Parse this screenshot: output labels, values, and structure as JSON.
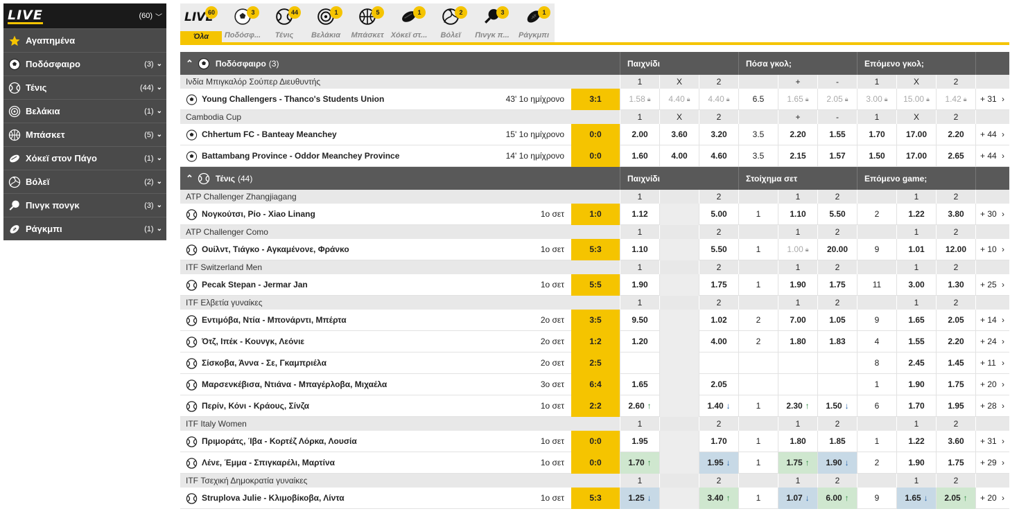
{
  "sidebar": {
    "logo": "LIVE",
    "count": "(60)",
    "items": [
      {
        "icon": "star-icon",
        "label": "Αγαπημένα",
        "count": ""
      },
      {
        "icon": "football-icon",
        "label": "Ποδόσφαιρο",
        "count": "(3)"
      },
      {
        "icon": "tennis-icon",
        "label": "Τένις",
        "count": "(44)"
      },
      {
        "icon": "darts-icon",
        "label": "Βελάκια",
        "count": "(1)"
      },
      {
        "icon": "basketball-icon",
        "label": "Μπάσκετ",
        "count": "(5)"
      },
      {
        "icon": "hockey-icon",
        "label": "Χόκεϊ στον Πάγο",
        "count": "(1)"
      },
      {
        "icon": "volleyball-icon",
        "label": "Βόλεϊ",
        "count": "(2)"
      },
      {
        "icon": "pingpong-icon",
        "label": "Πινγκ πονγκ",
        "count": "(3)"
      },
      {
        "icon": "rugby-icon",
        "label": "Ράγκμπι",
        "count": "(1)"
      }
    ]
  },
  "tabs": [
    {
      "icon": "live-icon",
      "label": "Όλα",
      "badge": "60",
      "active": true
    },
    {
      "icon": "football-icon",
      "label": "Ποδόσφ...",
      "badge": "3"
    },
    {
      "icon": "tennis-icon",
      "label": "Τένις",
      "badge": "44"
    },
    {
      "icon": "darts-icon",
      "label": "Βελάκια",
      "badge": "1"
    },
    {
      "icon": "basketball-icon",
      "label": "Μπάσκετ",
      "badge": "5"
    },
    {
      "icon": "hockey-icon",
      "label": "Χόκεϊ στ...",
      "badge": "1"
    },
    {
      "icon": "volleyball-icon",
      "label": "Βόλεϊ",
      "badge": "2"
    },
    {
      "icon": "pingpong-icon",
      "label": "Πινγκ π...",
      "badge": "3"
    },
    {
      "icon": "rugby-icon",
      "label": "Ράγκμπι",
      "badge": "1"
    }
  ],
  "sections": [
    {
      "sport": "Ποδόσφαιρο",
      "count": "(3)",
      "icon": "football-icon",
      "markets": [
        "Παιχνίδι",
        "Πόσα γκολ;",
        "Επόμενο γκολ;"
      ],
      "groups": [
        {
          "comp": "Ινδία Μπιγκαλόρ Σούπερ Διευθυντής",
          "heads": [
            "1",
            "X",
            "2",
            "",
            "+",
            "-",
            "1",
            "X",
            "2"
          ],
          "events": [
            {
              "teams": "Young Challengers - Thanco's Students Union",
              "time": "43' 1ο ημίχρονο",
              "score": "3:1",
              "odds": [
                {
                  "v": "1.58",
                  "s": "locked"
                },
                {
                  "v": "4.40",
                  "s": "locked"
                },
                {
                  "v": "4.40",
                  "s": "locked"
                },
                {
                  "v": "6.5",
                  "s": "nb"
                },
                {
                  "v": "1.65",
                  "s": "locked"
                },
                {
                  "v": "2.05",
                  "s": "locked"
                },
                {
                  "v": "3.00",
                  "s": "locked"
                },
                {
                  "v": "15.00",
                  "s": "locked"
                },
                {
                  "v": "1.42",
                  "s": "locked"
                }
              ],
              "more": "+ 31"
            }
          ]
        },
        {
          "comp": "Cambodia Cup",
          "heads": [
            "1",
            "X",
            "2",
            "",
            "+",
            "-",
            "1",
            "X",
            "2"
          ],
          "events": [
            {
              "teams": "Chhertum FC - Banteay Meanchey",
              "time": "15' 1ο ημίχρονο",
              "score": "0:0",
              "odds": [
                {
                  "v": "2.00"
                },
                {
                  "v": "3.60"
                },
                {
                  "v": "3.20"
                },
                {
                  "v": "3.5",
                  "s": "nb"
                },
                {
                  "v": "2.20"
                },
                {
                  "v": "1.55"
                },
                {
                  "v": "1.70"
                },
                {
                  "v": "17.00"
                },
                {
                  "v": "2.20"
                }
              ],
              "more": "+ 44"
            },
            {
              "teams": "Battambang Province - Oddor Meanchey Province",
              "time": "14' 1ο ημίχρονο",
              "score": "0:0",
              "odds": [
                {
                  "v": "1.60"
                },
                {
                  "v": "4.00"
                },
                {
                  "v": "4.60"
                },
                {
                  "v": "3.5",
                  "s": "nb"
                },
                {
                  "v": "2.15"
                },
                {
                  "v": "1.57"
                },
                {
                  "v": "1.50"
                },
                {
                  "v": "17.00"
                },
                {
                  "v": "2.65"
                }
              ],
              "more": "+ 44"
            }
          ]
        }
      ]
    },
    {
      "sport": "Τένις",
      "count": "(44)",
      "icon": "tennis-icon",
      "markets": [
        "Παιχνίδι",
        "Στοίχημα σετ",
        "Επόμενο game;"
      ],
      "groups": [
        {
          "comp": "ATP Challenger Zhangjiagang",
          "heads": [
            "1",
            "",
            "2",
            "",
            "1",
            "2",
            "",
            "1",
            "2"
          ],
          "events": [
            {
              "teams": "Νογκούτσι, Ρίο - Xiao Linang",
              "time": "1ο σετ",
              "score": "1:0",
              "odds": [
                {
                  "v": "1.12"
                },
                {
                  "v": "",
                  "s": "grey"
                },
                {
                  "v": "5.00"
                },
                {
                  "v": "1",
                  "s": "nb"
                },
                {
                  "v": "1.10"
                },
                {
                  "v": "5.50"
                },
                {
                  "v": "2",
                  "s": "nb"
                },
                {
                  "v": "1.22"
                },
                {
                  "v": "3.80"
                }
              ],
              "more": "+ 30"
            }
          ]
        },
        {
          "comp": "ATP Challenger Como",
          "heads": [
            "1",
            "",
            "2",
            "",
            "1",
            "2",
            "",
            "1",
            "2"
          ],
          "events": [
            {
              "teams": "Ουίλντ, Τιάγκο - Αγκαμένονε, Φράνκο",
              "time": "1ο σετ",
              "score": "5:3",
              "odds": [
                {
                  "v": "1.10"
                },
                {
                  "v": "",
                  "s": "grey"
                },
                {
                  "v": "5.50"
                },
                {
                  "v": "1",
                  "s": "nb"
                },
                {
                  "v": "1.00",
                  "s": "locked"
                },
                {
                  "v": "20.00"
                },
                {
                  "v": "9",
                  "s": "nb"
                },
                {
                  "v": "1.01"
                },
                {
                  "v": "12.00"
                }
              ],
              "more": "+ 10"
            }
          ]
        },
        {
          "comp": "ITF Switzerland Men",
          "heads": [
            "1",
            "",
            "2",
            "",
            "1",
            "2",
            "",
            "1",
            "2"
          ],
          "events": [
            {
              "teams": "Pecak Stepan - Jermar Jan",
              "time": "1ο σετ",
              "score": "5:5",
              "odds": [
                {
                  "v": "1.90"
                },
                {
                  "v": "",
                  "s": "grey"
                },
                {
                  "v": "1.75"
                },
                {
                  "v": "1",
                  "s": "nb"
                },
                {
                  "v": "1.90"
                },
                {
                  "v": "1.75"
                },
                {
                  "v": "11",
                  "s": "nb"
                },
                {
                  "v": "3.00"
                },
                {
                  "v": "1.30"
                }
              ],
              "more": "+ 25"
            }
          ]
        },
        {
          "comp": "ITF Ελβετία γυναίκες",
          "heads": [
            "1",
            "",
            "2",
            "",
            "1",
            "2",
            "",
            "1",
            "2"
          ],
          "events": [
            {
              "teams": "Εντιμόβα, Ντία - Μπονάρντι, Μπέρτα",
              "time": "2ο σετ",
              "score": "3:5",
              "odds": [
                {
                  "v": "9.50"
                },
                {
                  "v": "",
                  "s": "grey"
                },
                {
                  "v": "1.02"
                },
                {
                  "v": "2",
                  "s": "nb"
                },
                {
                  "v": "7.00"
                },
                {
                  "v": "1.05"
                },
                {
                  "v": "9",
                  "s": "nb"
                },
                {
                  "v": "1.65"
                },
                {
                  "v": "2.05"
                }
              ],
              "more": "+ 14"
            },
            {
              "teams": "Ότζ, Ιπέκ - Κουνγκ, Λεόνιε",
              "time": "2ο σετ",
              "score": "1:2",
              "odds": [
                {
                  "v": "1.20"
                },
                {
                  "v": "",
                  "s": "grey"
                },
                {
                  "v": "4.00"
                },
                {
                  "v": "2",
                  "s": "nb"
                },
                {
                  "v": "1.80"
                },
                {
                  "v": "1.83"
                },
                {
                  "v": "4",
                  "s": "nb"
                },
                {
                  "v": "1.55"
                },
                {
                  "v": "2.20"
                }
              ],
              "more": "+ 24"
            },
            {
              "teams": "Σίσκοβα, Άννα - Σε, Γκαμπριέλα",
              "time": "2ο σετ",
              "score": "2:5",
              "odds": [
                {
                  "v": ""
                },
                {
                  "v": "",
                  "s": "grey"
                },
                {
                  "v": ""
                },
                {
                  "v": "",
                  "s": "nb"
                },
                {
                  "v": ""
                },
                {
                  "v": ""
                },
                {
                  "v": "8",
                  "s": "nb"
                },
                {
                  "v": "2.45"
                },
                {
                  "v": "1.45"
                }
              ],
              "more": "+ 11"
            },
            {
              "teams": "Μαρσενκέβισα, Ντιάνα - Μπαγέρλοβα, Μιχαέλα",
              "time": "3ο σετ",
              "score": "6:4",
              "odds": [
                {
                  "v": "1.65"
                },
                {
                  "v": "",
                  "s": "grey"
                },
                {
                  "v": "2.05"
                },
                {
                  "v": "",
                  "s": "nb"
                },
                {
                  "v": ""
                },
                {
                  "v": ""
                },
                {
                  "v": "1",
                  "s": "nb"
                },
                {
                  "v": "1.90"
                },
                {
                  "v": "1.75"
                }
              ],
              "more": "+ 20"
            },
            {
              "teams": "Περίν, Κόνι - Κράους, Σίνζα",
              "time": "1ο σετ",
              "score": "2:2",
              "odds": [
                {
                  "v": "2.60",
                  "a": "up"
                },
                {
                  "v": "",
                  "s": "grey"
                },
                {
                  "v": "1.40",
                  "a": "down"
                },
                {
                  "v": "1",
                  "s": "nb"
                },
                {
                  "v": "2.30",
                  "a": "up"
                },
                {
                  "v": "1.50",
                  "a": "down"
                },
                {
                  "v": "6",
                  "s": "nb"
                },
                {
                  "v": "1.70"
                },
                {
                  "v": "1.95"
                }
              ],
              "more": "+ 28"
            }
          ]
        },
        {
          "comp": "ITF Italy Women",
          "heads": [
            "1",
            "",
            "2",
            "",
            "1",
            "2",
            "",
            "1",
            "2"
          ],
          "events": [
            {
              "teams": "Πριμοράτς, Ίβα - Κορτέζ Λόρκα, Λουσία",
              "time": "1ο σετ",
              "score": "0:0",
              "odds": [
                {
                  "v": "1.95"
                },
                {
                  "v": "",
                  "s": "grey"
                },
                {
                  "v": "1.70"
                },
                {
                  "v": "1",
                  "s": "nb"
                },
                {
                  "v": "1.80"
                },
                {
                  "v": "1.85"
                },
                {
                  "v": "1",
                  "s": "nb"
                },
                {
                  "v": "1.22"
                },
                {
                  "v": "3.60"
                }
              ],
              "more": "+ 31"
            },
            {
              "teams": "Λένε, Έμμα - Σπιγκαρέλι, Μαρτίνα",
              "time": "1ο σετ",
              "score": "0:0",
              "odds": [
                {
                  "v": "1.70",
                  "a": "up",
                  "s": "up"
                },
                {
                  "v": "",
                  "s": "grey"
                },
                {
                  "v": "1.95",
                  "a": "down",
                  "s": "down"
                },
                {
                  "v": "1",
                  "s": "nb"
                },
                {
                  "v": "1.75",
                  "a": "up",
                  "s": "up"
                },
                {
                  "v": "1.90",
                  "a": "down",
                  "s": "down"
                },
                {
                  "v": "2",
                  "s": "nb"
                },
                {
                  "v": "1.90"
                },
                {
                  "v": "1.75"
                }
              ],
              "more": "+ 29"
            }
          ]
        },
        {
          "comp": "ITF Τσεχική Δημοκρατία γυναίκες",
          "heads": [
            "1",
            "",
            "2",
            "",
            "1",
            "2",
            "",
            "1",
            "2"
          ],
          "events": [
            {
              "teams": "Struplova Julie - Κλιμοβίκοβα, Λίντα",
              "time": "1ο σετ",
              "score": "5:3",
              "odds": [
                {
                  "v": "1.25",
                  "a": "down",
                  "s": "down"
                },
                {
                  "v": "",
                  "s": "grey"
                },
                {
                  "v": "3.40",
                  "a": "up",
                  "s": "up"
                },
                {
                  "v": "1",
                  "s": "nb"
                },
                {
                  "v": "1.07",
                  "a": "down",
                  "s": "down"
                },
                {
                  "v": "6.00",
                  "a": "up",
                  "s": "up"
                },
                {
                  "v": "9",
                  "s": "nb"
                },
                {
                  "v": "1.65",
                  "a": "down",
                  "s": "down"
                },
                {
                  "v": "2.05",
                  "a": "up",
                  "s": "up"
                }
              ],
              "more": "+ 20"
            }
          ]
        }
      ]
    }
  ],
  "colors": {
    "accent": "#f5c400",
    "dark": "#1a1a1a",
    "sidebar": "#4a4a4a",
    "header": "#595959",
    "up": "#cfe7cf",
    "down": "#c7d9e6"
  }
}
